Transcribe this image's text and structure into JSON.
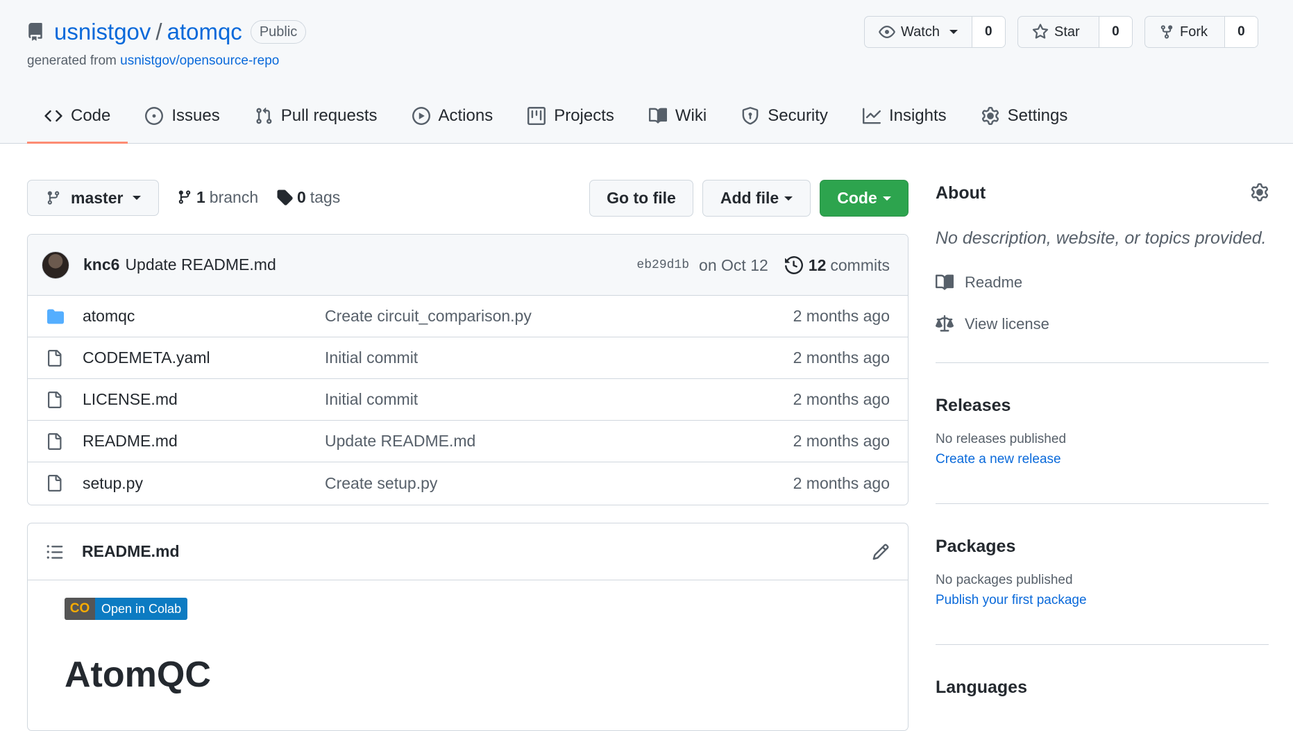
{
  "repo": {
    "owner": "usnistgov",
    "separator": "/",
    "name": "atomqc",
    "visibility": "Public",
    "generated_prefix": "generated from ",
    "generated_source": "usnistgov/opensource-repo"
  },
  "actions": {
    "watch": {
      "label": "Watch",
      "count": "0"
    },
    "star": {
      "label": "Star",
      "count": "0"
    },
    "fork": {
      "label": "Fork",
      "count": "0"
    }
  },
  "tabs": [
    {
      "label": "Code",
      "icon": "code-icon",
      "active": true
    },
    {
      "label": "Issues",
      "icon": "issue-icon"
    },
    {
      "label": "Pull requests",
      "icon": "pull-request-icon"
    },
    {
      "label": "Actions",
      "icon": "play-icon"
    },
    {
      "label": "Projects",
      "icon": "project-icon"
    },
    {
      "label": "Wiki",
      "icon": "book-icon"
    },
    {
      "label": "Security",
      "icon": "shield-icon"
    },
    {
      "label": "Insights",
      "icon": "graph-icon"
    },
    {
      "label": "Settings",
      "icon": "gear-icon"
    }
  ],
  "toolbar": {
    "branch_name": "master",
    "branch_count": "1",
    "branch_label": "branch",
    "tag_count": "0",
    "tag_label": "tags",
    "go_to_file": "Go to file",
    "add_file": "Add file",
    "code": "Code"
  },
  "latest_commit": {
    "author": "knc6",
    "message": "Update README.md",
    "sha": "eb29d1b",
    "date": "on Oct 12",
    "commit_count": "12",
    "commit_label": "commits"
  },
  "files": [
    {
      "type": "folder",
      "name": "atomqc",
      "message": "Create circuit_comparison.py",
      "age": "2 months ago"
    },
    {
      "type": "file",
      "name": "CODEMETA.yaml",
      "message": "Initial commit",
      "age": "2 months ago"
    },
    {
      "type": "file",
      "name": "LICENSE.md",
      "message": "Initial commit",
      "age": "2 months ago"
    },
    {
      "type": "file",
      "name": "README.md",
      "message": "Update README.md",
      "age": "2 months ago"
    },
    {
      "type": "file",
      "name": "setup.py",
      "message": "Create setup.py",
      "age": "2 months ago"
    }
  ],
  "readme": {
    "filename": "README.md",
    "badge_logo": "CO",
    "badge_label": "Open in Colab",
    "heading": "AtomQC"
  },
  "sidebar": {
    "about_title": "About",
    "about_description": "No description, website, or topics provided.",
    "readme_link": "Readme",
    "license_link": "View license",
    "releases_title": "Releases",
    "releases_note": "No releases published",
    "releases_action": "Create a new release",
    "packages_title": "Packages",
    "packages_note": "No packages published",
    "packages_action": "Publish your first package",
    "languages_title": "Languages"
  },
  "colors": {
    "link": "#0969da",
    "primary_button": "#2da44e",
    "active_tab_underline": "#fd8c73",
    "folder": "#54aeff"
  }
}
